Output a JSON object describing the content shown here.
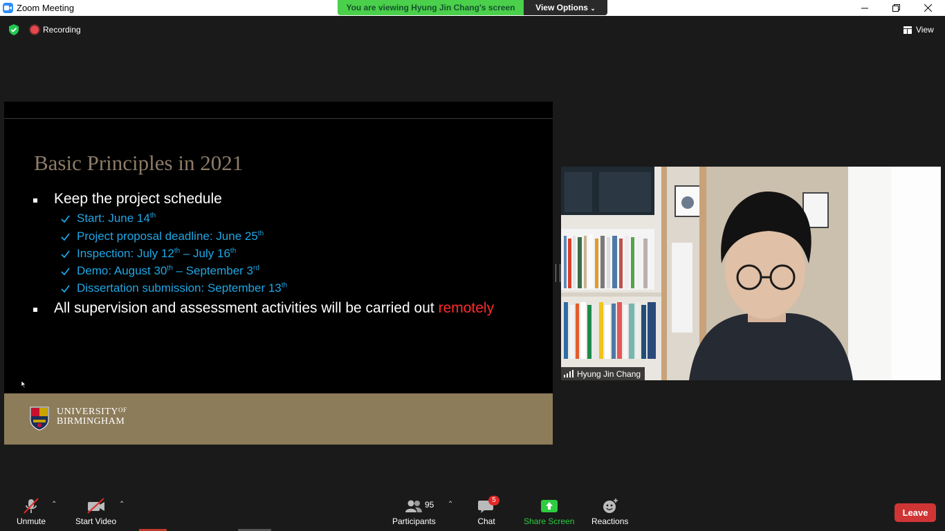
{
  "window": {
    "title": "Zoom Meeting",
    "controls": [
      "minimize-icon",
      "restore-icon",
      "close-icon"
    ]
  },
  "banner": {
    "text": "You are viewing Hyung Jin Chang's screen",
    "view_options": "View Options"
  },
  "topbar": {
    "recording": "Recording",
    "view": "View"
  },
  "slide": {
    "title": "Basic Principles in 2021",
    "bullet1": "Keep the project schedule",
    "items": [
      {
        "text": "Start: June 14",
        "sup": "th"
      },
      {
        "text": "Project proposal deadline: June 25",
        "sup": "th"
      },
      {
        "text": "Inspection: July 12",
        "sup": "th",
        "text2": " – July 16",
        "sup2": "th"
      },
      {
        "text": "Demo: August 30",
        "sup": "th",
        "text2": " – September 3",
        "sup2": "rd"
      },
      {
        "text": "Dissertation submission: September 13",
        "sup": "th"
      }
    ],
    "bullet2_prefix": "All supervision and assessment activities will be carried out ",
    "bullet2_highlight": "remotely",
    "university_line1": "UNIVERSITY",
    "university_of": "OF",
    "university_line2": "BIRMINGHAM",
    "accent_title": "#8d7c68",
    "accent_sub": "#1fa7e5",
    "accent_footer": "#8d7c5a",
    "accent_remote": "#ff2a2a"
  },
  "video": {
    "participant_name": "Hyung Jin Chang"
  },
  "toolbar": {
    "unmute": "Unmute",
    "start_video": "Start Video",
    "participants": "Participants",
    "participants_count": "95",
    "chat": "Chat",
    "chat_badge": "5",
    "share_screen": "Share Screen",
    "reactions": "Reactions",
    "leave": "Leave",
    "share_color": "#2ecc40",
    "leave_color": "#d03535"
  }
}
